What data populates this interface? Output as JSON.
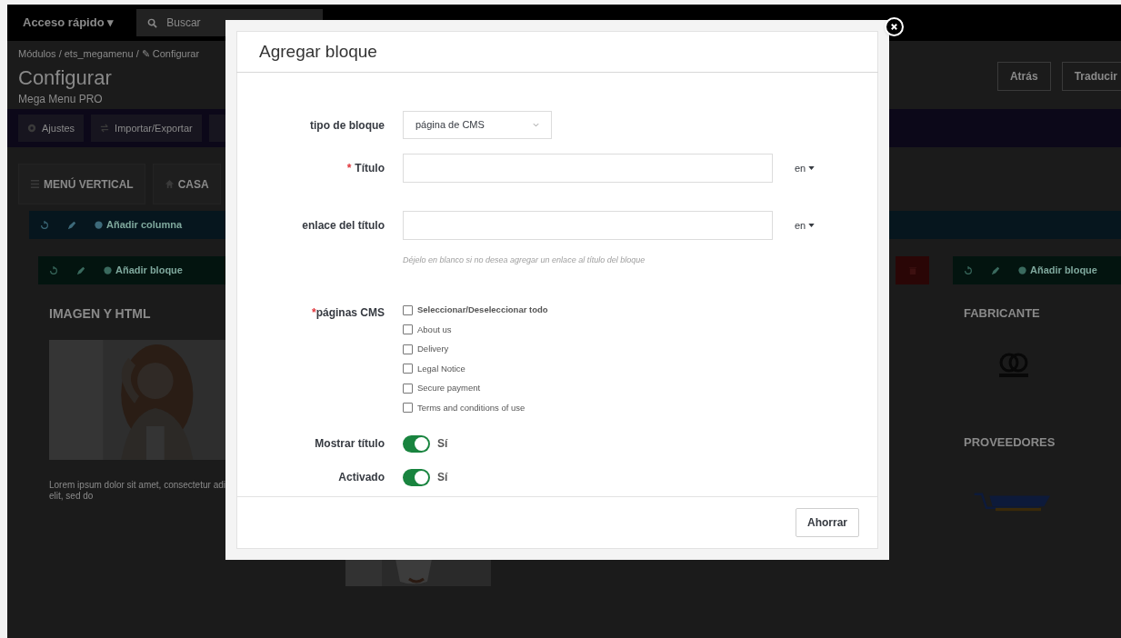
{
  "topbar": {
    "quick_access": "Acceso rápido ▾",
    "search_placeholder": "Buscar"
  },
  "breadcrumb": "Módulos / ets_megamenu / ✎ Configurar",
  "page_title": "Configurar",
  "page_subtitle": "Mega Menu PRO",
  "header_buttons": [
    "Atrás",
    "Traducir"
  ],
  "toolbar_buttons": [
    {
      "label": "Ajustes"
    },
    {
      "label": "Importar/Exportar"
    }
  ],
  "menu_tabs": [
    {
      "label": "MENÚ VERTICAL"
    },
    {
      "label": "CASA"
    }
  ],
  "column_bar": {
    "label": "Añadir columna"
  },
  "left_block": {
    "bar_label": "Añadir bloque",
    "title": "IMAGEN Y HTML",
    "text": "Lorem ipsum dolor sit amet, consectetur adi\nelit, sed do"
  },
  "right_block": {
    "bar_label": "Añadir bloque",
    "sections": [
      {
        "title": "FABRICANTE"
      },
      {
        "title": "PROVEEDORES"
      }
    ]
  },
  "modal": {
    "title": "Agregar bloque",
    "fields": [
      {
        "kind": "select",
        "label": "tipo de bloque",
        "value": "página de CMS"
      },
      {
        "kind": "text",
        "label": "Título",
        "required_mark": "*",
        "language": "en"
      },
      {
        "kind": "text",
        "label": "enlace del título",
        "language": "en",
        "help": "Déjelo en blanco si no desea agregar un enlace al título del bloque"
      },
      {
        "kind": "checklist",
        "label": "páginas CMS",
        "required_mark": "*",
        "options": [
          {
            "label": "Seleccionar/Deseleccionar todo",
            "checked": false,
            "bold": true
          },
          {
            "label": "About us",
            "checked": false,
            "bold": false
          },
          {
            "label": "Delivery",
            "checked": false,
            "bold": false
          },
          {
            "label": "Legal Notice",
            "checked": false,
            "bold": false
          },
          {
            "label": "Secure payment",
            "checked": false,
            "bold": false
          },
          {
            "label": "Terms and conditions of use",
            "checked": false,
            "bold": false
          }
        ]
      },
      {
        "kind": "toggle",
        "label": "Mostrar título",
        "on": true,
        "state_label": "Sí"
      },
      {
        "kind": "toggle",
        "label": "Activado",
        "on": true,
        "state_label": "Sí"
      }
    ],
    "save_button": "Ahorrar"
  }
}
